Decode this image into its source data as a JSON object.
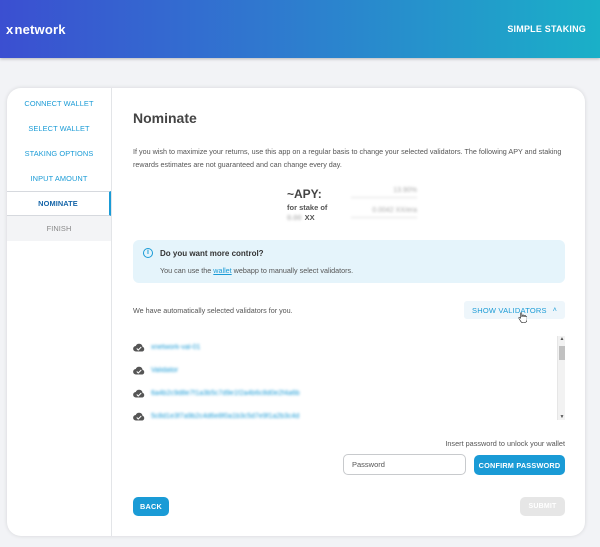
{
  "header": {
    "logo_symbol": "x",
    "logo_text": "network",
    "nav_link": "SIMPLE STAKING"
  },
  "sidebar": {
    "steps": [
      {
        "label": "CONNECT WALLET",
        "state": "done"
      },
      {
        "label": "SELECT WALLET",
        "state": "done"
      },
      {
        "label": "STAKING OPTIONS",
        "state": "done"
      },
      {
        "label": "INPUT AMOUNT",
        "state": "done"
      },
      {
        "label": "NOMINATE",
        "state": "active"
      },
      {
        "label": "FINISH",
        "state": "disabled"
      }
    ]
  },
  "main": {
    "title": "Nominate",
    "intro": "If you wish to maximize your returns, use this app on a regular basis to change your selected validators. The following APY and staking rewards estimates are not guaranteed and can change every day.",
    "apy": {
      "label": "~APY:",
      "stake_prefix": "for stake of",
      "stake_amount": "0.00",
      "stake_unit": "XX",
      "apy_value": "13.90%",
      "rewards_value": "0.0042 XX/era"
    },
    "info": {
      "icon": "info-circle-icon",
      "title": "Do you want more control?",
      "text_before": "You can use the ",
      "link": "wallet",
      "text_after": " webapp to manually select validators."
    },
    "auto_selected_text": "We have automatically selected validators for you.",
    "show_validators_label": "SHOW VALIDATORS",
    "validators": [
      {
        "name": "xnetwork-val-01",
        "icon": "cloud-check-icon"
      },
      {
        "name": "Validator",
        "icon": "cloud-check-icon"
      },
      {
        "name": "6a4b2c9d8e7f1a3b5c7d9e1f2a4b6c8d0e2f4a6b",
        "icon": "cloud-check-icon"
      },
      {
        "name": "5c8d1e3f7a9b2c4d6e8f0a1b3c5d7e9f1a2b3c4d",
        "icon": "cloud-check-icon"
      }
    ],
    "password_prompt": "Insert password to unlock your wallet",
    "password_placeholder": "Password",
    "confirm_label": "CONFIRM PASSWORD",
    "back_label": "BACK",
    "submit_label": "SUBMIT"
  },
  "colors": {
    "accent": "#1a9bd6",
    "info_bg": "#e5f4fb",
    "header_start": "#3b4fd1",
    "header_end": "#1ab0c8"
  }
}
